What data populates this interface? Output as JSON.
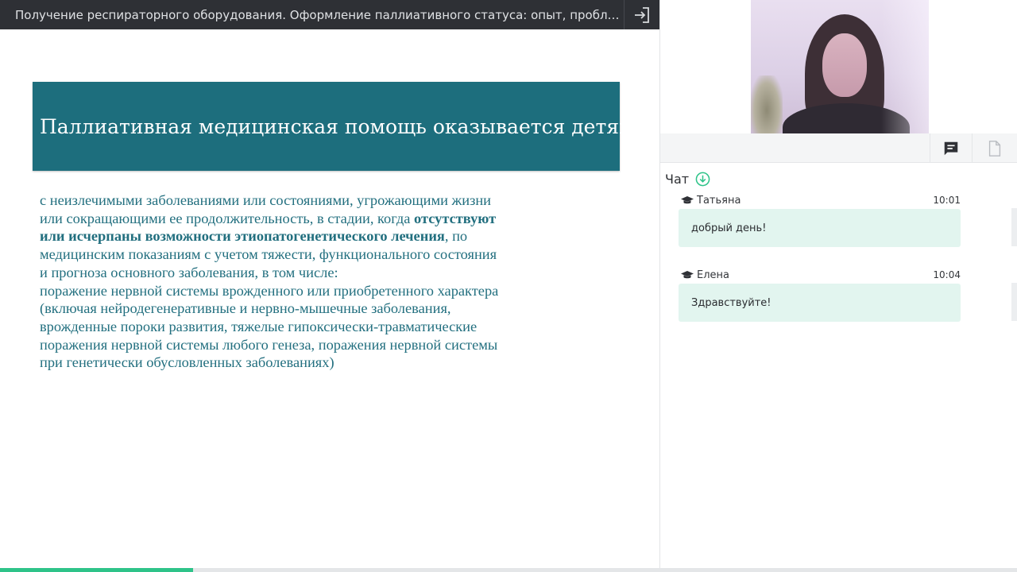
{
  "topbar": {
    "title": "Получение респираторного оборудования. Оформление паллиативного статуса: опыт, проблемы, пути решения",
    "exit_icon": "exit-icon"
  },
  "slide": {
    "heading": "Паллиативная медицинская помощь оказывается детям",
    "lines": [
      {
        "pre": "с неизлечимыми заболеваниями или состояниями, угрожающими жизни",
        "bold": "",
        "post": ""
      },
      {
        "pre": "или сокращающими ее продолжительность, в стадии, когда ",
        "bold": "отсутствуют",
        "post": ""
      },
      {
        "pre": "",
        "bold": "или исчерпаны возможности этиопатогенетического лечения",
        "post": ", по"
      },
      {
        "pre": "медицинским показаниям с учетом тяжести, функционального состояния",
        "bold": "",
        "post": ""
      },
      {
        "pre": "и прогноза основного заболевания, в том числе:",
        "bold": "",
        "post": ""
      },
      {
        "pre": "поражение нервной системы врожденного или приобретенного характера",
        "bold": "",
        "post": ""
      },
      {
        "pre": "(включая нейродегенеративные и нервно-мышечные заболевания,",
        "bold": "",
        "post": ""
      },
      {
        "pre": "врожденные пороки развития, тяжелые гипоксически-травматические",
        "bold": "",
        "post": ""
      },
      {
        "pre": "поражения нервной системы любого генеза, поражения нервной системы",
        "bold": "",
        "post": ""
      },
      {
        "pre": "при генетически обусловленных заболеваниях)",
        "bold": "",
        "post": ""
      }
    ],
    "progress_fraction": 0.19
  },
  "panel": {
    "tabs": [
      {
        "icon": "chat-icon",
        "active": true
      },
      {
        "icon": "document-icon",
        "active": false
      }
    ]
  },
  "chat": {
    "title": "Чат",
    "messages": [
      {
        "author": "Татьяна",
        "time": "10:01",
        "text": "добрый день!",
        "role_icon": "graduation-cap-icon"
      },
      {
        "author": "Елена",
        "time": "10:04",
        "text": "Здравствуйте!",
        "role_icon": "graduation-cap-icon"
      }
    ]
  },
  "colors": {
    "banner": "#1d6e7d",
    "slide_text": "#226f7f",
    "topbar": "#2e3035",
    "bubble": "#e2f5ef",
    "accent": "#2ec389"
  }
}
